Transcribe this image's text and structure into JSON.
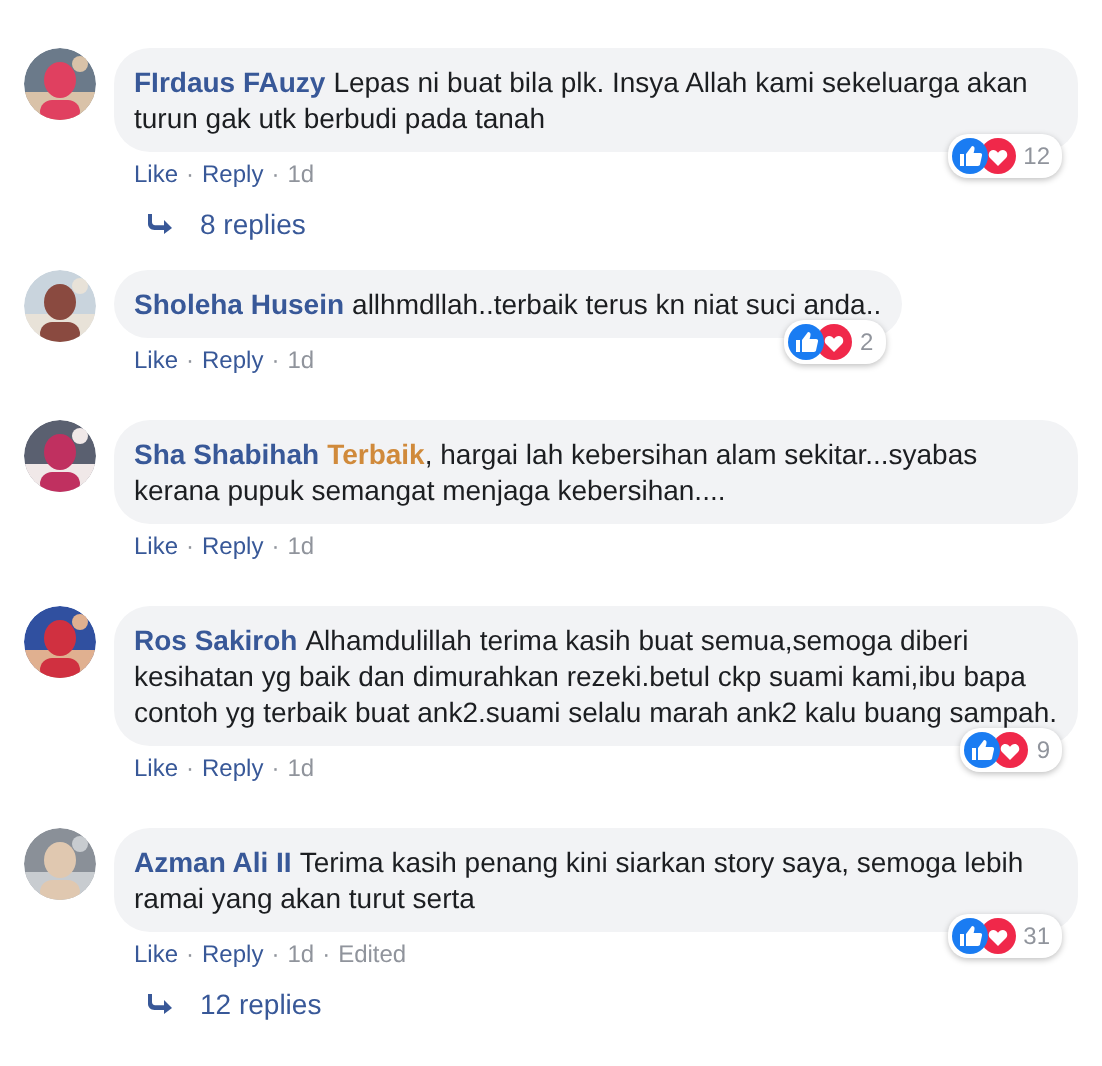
{
  "separator": "·",
  "comments": [
    {
      "author": "FIrdaus FAuzy",
      "text": "Lepas ni buat bila plk. Insya Allah kami sekeluarga akan turun gak utk berbudi pada tanah",
      "actions": [
        {
          "label": "Like",
          "kind": "link"
        },
        {
          "label": "Reply",
          "kind": "link"
        },
        {
          "label": "1d",
          "kind": "meta"
        }
      ],
      "reaction_count": "12",
      "replies": "8 replies"
    },
    {
      "author": "Sholeha Husein",
      "text": "allhmdllah..terbaik terus kn niat suci anda..",
      "actions": [
        {
          "label": "Like",
          "kind": "link"
        },
        {
          "label": "Reply",
          "kind": "link"
        },
        {
          "label": "1d",
          "kind": "meta"
        }
      ],
      "reaction_count": "2"
    },
    {
      "author": "Sha Shabihah",
      "tag": "Terbaik",
      "text": ", hargai lah kebersihan alam sekitar...syabas kerana pupuk semangat menjaga kebersihan....",
      "actions": [
        {
          "label": "Like",
          "kind": "link"
        },
        {
          "label": "Reply",
          "kind": "link"
        },
        {
          "label": "1d",
          "kind": "meta"
        }
      ]
    },
    {
      "author": "Ros Sakiroh",
      "text": "Alhamdulillah terima kasih buat semua,semoga diberi kesihatan yg baik dan dimurahkan rezeki.betul ckp suami kami,ibu bapa contoh yg terbaik buat ank2.suami selalu marah ank2 kalu buang sampah.",
      "actions": [
        {
          "label": "Like",
          "kind": "link"
        },
        {
          "label": "Reply",
          "kind": "link"
        },
        {
          "label": "1d",
          "kind": "meta"
        }
      ],
      "reaction_count": "9"
    },
    {
      "author": "Azman Ali II",
      "text": "Terima kasih penang kini siarkan story saya, semoga lebih ramai yang akan turut serta",
      "actions": [
        {
          "label": "Like",
          "kind": "link"
        },
        {
          "label": "Reply",
          "kind": "link"
        },
        {
          "label": "1d",
          "kind": "meta"
        },
        {
          "label": "Edited",
          "kind": "meta"
        }
      ],
      "reaction_count": "31",
      "replies": "12 replies"
    }
  ]
}
